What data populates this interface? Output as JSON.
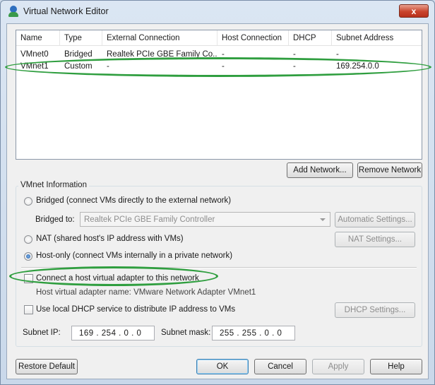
{
  "window": {
    "title": "Virtual Network Editor",
    "close_label": "x"
  },
  "network_list": {
    "columns": [
      "Name",
      "Type",
      "External Connection",
      "Host Connection",
      "DHCP",
      "Subnet Address"
    ],
    "rows": [
      {
        "name": "VMnet0",
        "type": "Bridged",
        "external": "Realtek PCIe GBE Family Co...",
        "host": "-",
        "dhcp": "-",
        "subnet": "-"
      },
      {
        "name": "VMnet1",
        "type": "Custom",
        "external": "-",
        "host": "-",
        "dhcp": "-",
        "subnet": "169.254.0.0"
      }
    ]
  },
  "list_buttons": {
    "add": "Add Network...",
    "remove": "Remove Network"
  },
  "vmnet_info": {
    "group_label": "VMnet Information",
    "bridged_label": "Bridged (connect VMs directly to the external network)",
    "bridged_to_label": "Bridged to:",
    "bridged_to_value": "Realtek PCIe GBE Family Controller",
    "automatic_settings": "Automatic Settings...",
    "nat_label": "NAT (shared host's IP address with VMs)",
    "nat_settings": "NAT Settings...",
    "hostonly_label": "Host-only (connect VMs internally in a private network)",
    "connect_adapter_label": "Connect a host virtual adapter to this network",
    "adapter_name_text": "Host virtual adapter name: VMware Network Adapter VMnet1",
    "dhcp_label": "Use local DHCP service to distribute IP address to VMs",
    "dhcp_settings": "DHCP Settings...",
    "subnet_ip_label": "Subnet IP:",
    "subnet_ip_value": "169 . 254 .  0  .  0",
    "subnet_mask_label": "Subnet mask:",
    "subnet_mask_value": "255 . 255 .  0  .  0"
  },
  "footer": {
    "restore_default": "Restore Default",
    "ok": "OK",
    "cancel": "Cancel",
    "apply": "Apply",
    "help": "Help"
  },
  "colors": {
    "highlight_ellipse": "#2f9e3f",
    "close_button": "#c9442c"
  }
}
